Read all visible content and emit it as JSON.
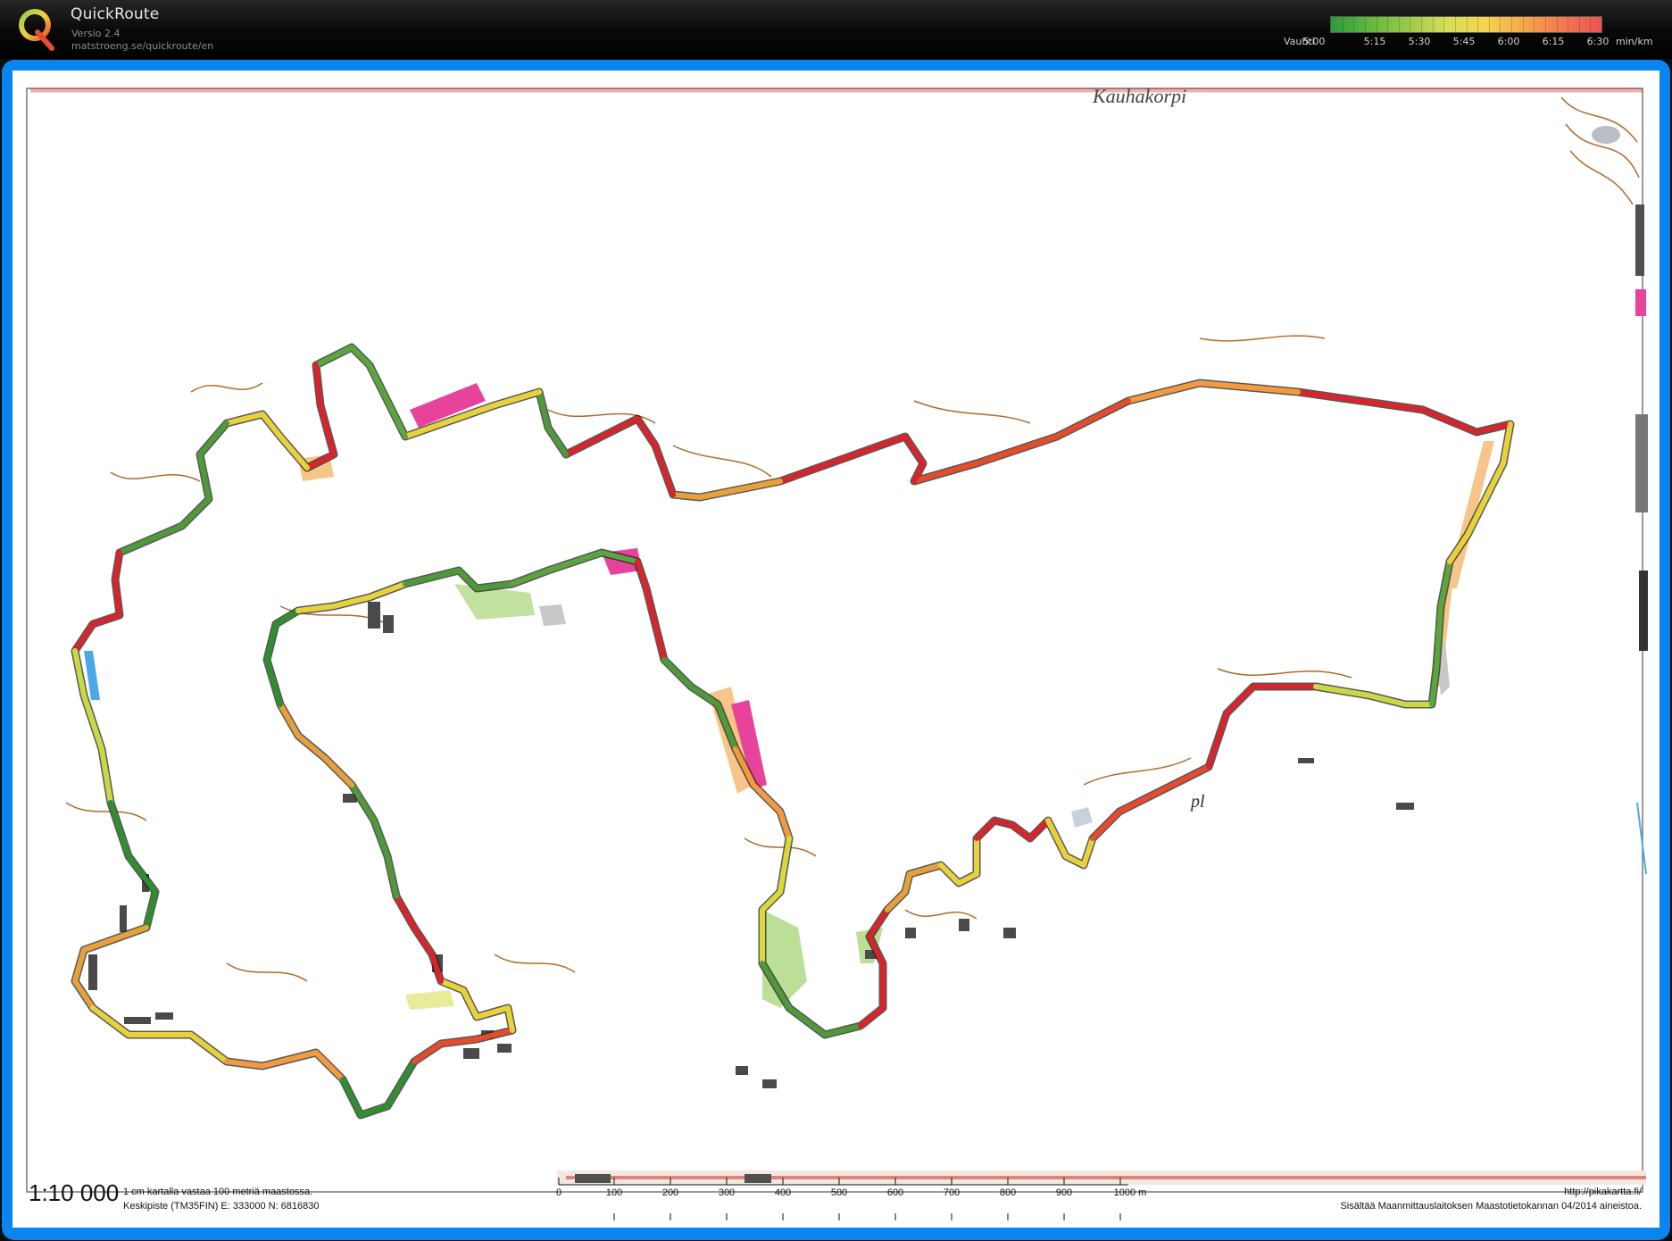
{
  "app": {
    "title": "QuickRoute",
    "version": "Versio 2.4",
    "url": "matstroeng.se/quickroute/en"
  },
  "legend": {
    "title": "Vauhti",
    "ticks": [
      "5:00",
      "5:15",
      "5:30",
      "5:45",
      "6:00",
      "6:15",
      "6:30"
    ],
    "unit": "min/km",
    "colors": [
      "#2e9a3a",
      "#62b83f",
      "#9cc94a",
      "#d7de56",
      "#f3d451",
      "#f6a74a",
      "#f27a4d",
      "#ec5353"
    ]
  },
  "colors": {
    "frame": "#0a84f0",
    "route_slow": "#d8242a",
    "route_mid": "#e8d23a",
    "route_fast": "#2f8f2f",
    "contour": "#b06a2a",
    "building": "#505050",
    "pink_area": "#e8439a",
    "orange_area": "#f6c58a",
    "green_area": "#9ed26a",
    "water": "#4da8e8"
  },
  "map": {
    "scale": "1:10 000",
    "scale_note": "1 cm kartalla vastaa 100 metriä maastossa.",
    "center": "Keskipiste (TM35FIN)  E: 333000  N: 6816830",
    "scale_labels": [
      "0",
      "100",
      "200",
      "300",
      "400",
      "500",
      "600",
      "700",
      "800",
      "900",
      "1000 m"
    ],
    "credits_url": "http://pikakartta.fi/",
    "credits_source": "Sisältää Maanmittauslaitoksen Maastotietokannan 04/2014 aineistoa.",
    "top_label": "Kauhakorpi",
    "road_label": "pl"
  }
}
